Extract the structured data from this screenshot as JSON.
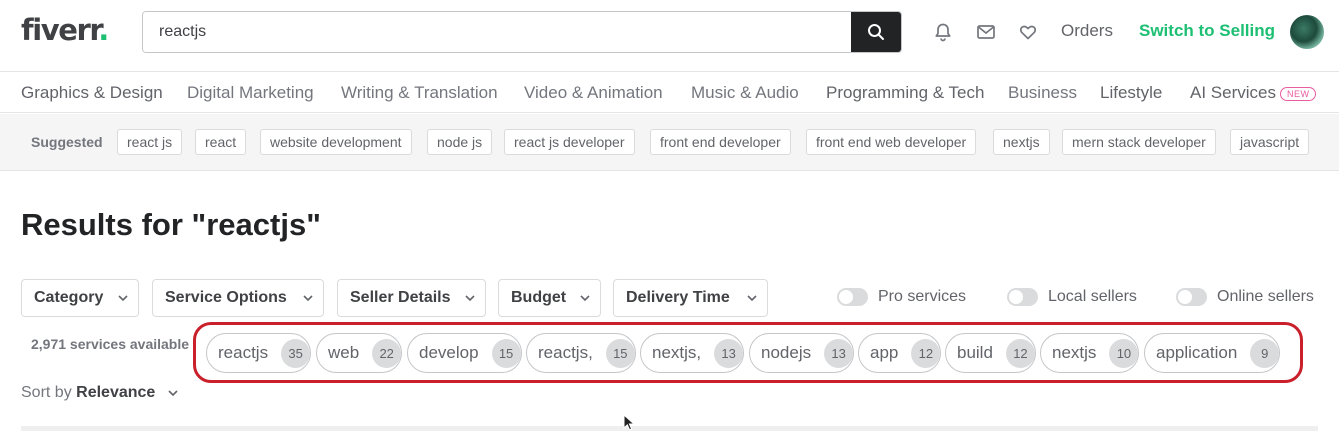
{
  "header": {
    "logo_text": "fiverr",
    "logo_dot": ".",
    "search_value": "reactjs",
    "orders_label": "Orders",
    "switch_label": "Switch to Selling"
  },
  "categories": [
    "Graphics & Design",
    "Digital Marketing",
    "Writing & Translation",
    "Video & Animation",
    "Music & Audio",
    "Programming & Tech",
    "Business",
    "Lifestyle",
    "AI Services"
  ],
  "new_badge": "NEW",
  "suggested": {
    "label": "Suggested",
    "chips": [
      "react js",
      "react",
      "website development",
      "node js",
      "react js developer",
      "front end developer",
      "front end web developer",
      "nextjs",
      "mern stack developer",
      "javascript"
    ]
  },
  "results": {
    "title": "Results for \"reactjs\"",
    "filters": [
      "Category",
      "Service Options",
      "Seller Details",
      "Budget",
      "Delivery Time"
    ],
    "toggles": [
      "Pro services",
      "Local sellers",
      "Online sellers"
    ],
    "services_count": "2,971 services available",
    "tags": [
      {
        "text": "reactjs",
        "count": "35"
      },
      {
        "text": "web",
        "count": "22"
      },
      {
        "text": "develop",
        "count": "15"
      },
      {
        "text": "reactjs,",
        "count": "15"
      },
      {
        "text": "nextjs,",
        "count": "13"
      },
      {
        "text": "nodejs",
        "count": "13"
      },
      {
        "text": "app",
        "count": "12"
      },
      {
        "text": "build",
        "count": "12"
      },
      {
        "text": "nextjs",
        "count": "10"
      },
      {
        "text": "application",
        "count": "9"
      }
    ],
    "sort_label": "Sort by",
    "sort_value": "Relevance"
  },
  "colors": {
    "brand_green": "#1dbf73",
    "highlight_red": "#c9202b",
    "new_pink": "#e95ca0"
  },
  "icons": [
    "search-icon",
    "bell-icon",
    "mail-icon",
    "heart-icon",
    "chevron-down-icon",
    "cursor-icon"
  ]
}
